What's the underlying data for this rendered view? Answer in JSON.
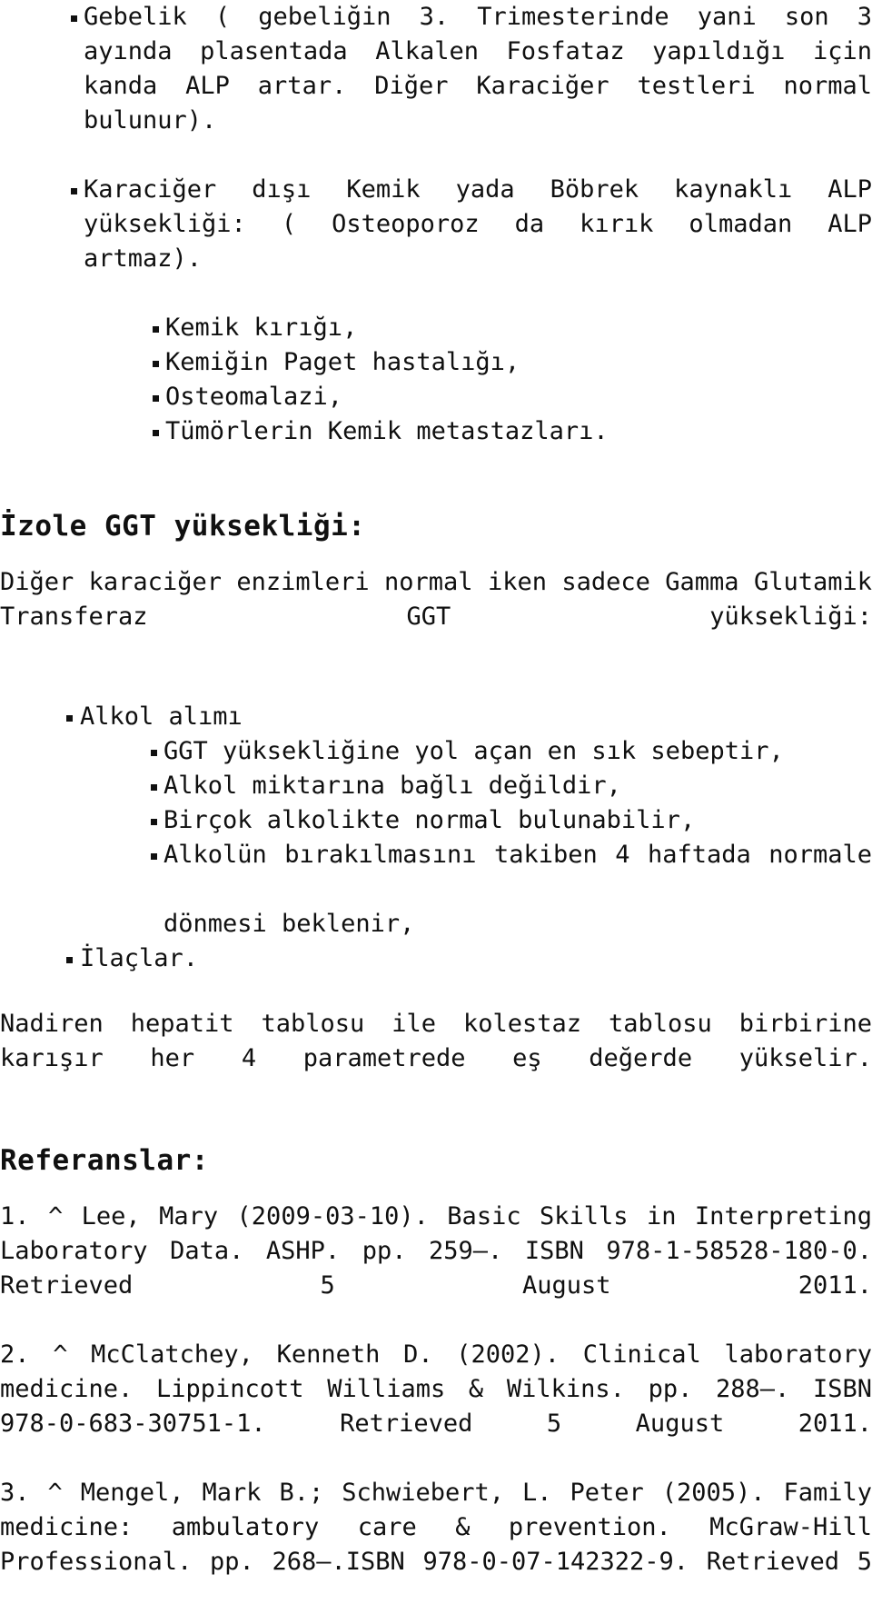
{
  "document": {
    "language": "tr",
    "background_color": "#ffffff",
    "text_color": "#101010",
    "bullet_glyph": "square-bullet"
  },
  "alp_section": {
    "bullets": [
      {
        "level": 1,
        "text": "Gebelik ( gebeliğin 3. Trimesterinde yani son 3 ayında plasentada Alkalen Fosfataz yapıldığı için kanda ALP artar. Diğer Karaciğer testleri normal bulunur)."
      },
      {
        "level": 1,
        "text": "Karaciğer dışı Kemik yada Böbrek kaynaklı ALP yüksekliği: ( Osteoporoz da kırık olmadan ALP artmaz)."
      },
      {
        "level": 2,
        "text": "Kemik kırığı,"
      },
      {
        "level": 2,
        "text": "Kemiğin Paget hastalığı,"
      },
      {
        "level": 2,
        "text": "Osteomalazi,"
      },
      {
        "level": 2,
        "text": "Tümörlerin Kemik metastazları."
      }
    ]
  },
  "ggt_section": {
    "heading": "İzole GGT yüksekliği:",
    "intro": "Diğer karaciğer enzimleri normal iken sadece Gamma Glutamik Transferaz GGT yüksekliği:",
    "bullets": [
      {
        "level": 1,
        "text": "Alkol alımı"
      },
      {
        "level": 2,
        "text": "GGT yüksekliğine yol açan en sık sebeptir,"
      },
      {
        "level": 2,
        "text": "Alkol miktarına bağlı değildir,"
      },
      {
        "level": 2,
        "text": "Birçok alkolikte normal bulunabilir,"
      },
      {
        "level": 2,
        "text": "Alkolün bırakılmasını takiben 4 haftada normale",
        "continuation": "dönmesi beklenir,"
      },
      {
        "level": 1,
        "text": "İlaçlar."
      }
    ],
    "closing": "Nadiren hepatit tablosu ile kolestaz tablosu birbirine karışır her 4 parametrede eş değerde yükselir."
  },
  "references": {
    "heading": "Referanslar:",
    "items": [
      "1. ^ Lee, Mary (2009-03-10). Basic Skills in Interpreting Laboratory Data. ASHP. pp. 259–. ISBN 978-1-58528-180-0. Retrieved 5 August 2011.",
      "2. ^ McClatchey, Kenneth D. (2002). Clinical laboratory medicine. Lippincott Williams & Wilkins. pp. 288–. ISBN 978-0-683-30751-1. Retrieved 5 August 2011.",
      "3. ^ Mengel, Mark B.; Schwiebert, L. Peter (2005). Family medicine: ambulatory care & prevention. McGraw-Hill Professional. pp. 268–.ISBN 978-0-07-142322-9. Retrieved 5"
    ]
  }
}
